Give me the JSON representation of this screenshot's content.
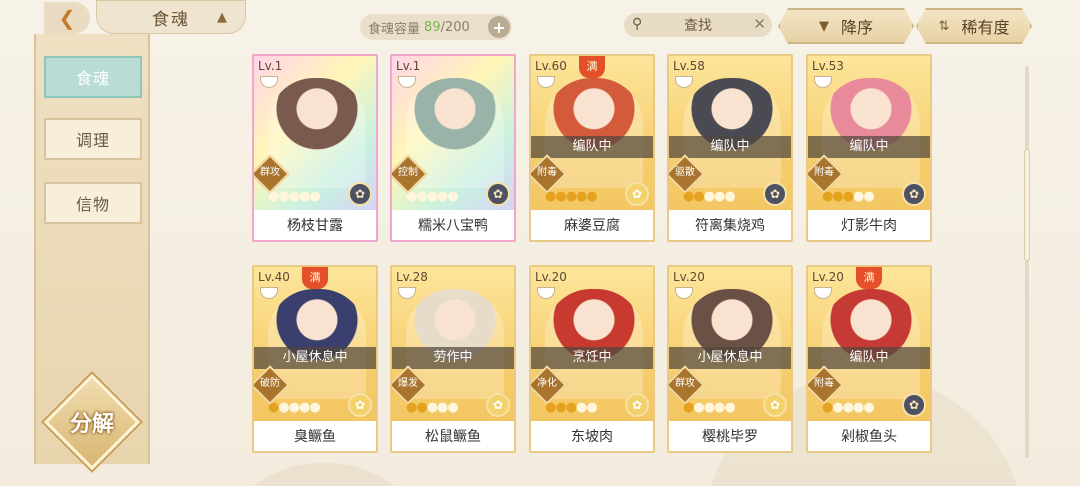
{
  "header": {
    "back_icon": "chevron-left-icon",
    "title": "食魂",
    "capacity_label": "食魂容量",
    "capacity_current": "89",
    "capacity_max": "/200",
    "search_label": "查找",
    "sort_order_label": "降序",
    "sort_key_label": "稀有度"
  },
  "sidebar": {
    "items": [
      {
        "label": "食魂",
        "active": true
      },
      {
        "label": "调理",
        "active": false
      },
      {
        "label": "信物",
        "active": false
      }
    ],
    "decompose_label": "分解"
  },
  "cards": [
    {
      "level": "Lv.1",
      "name": "杨枝甘露",
      "status": "",
      "role": "群攻",
      "stars": 0,
      "full": false,
      "rainbow": true,
      "flower": "dark",
      "portrait_color": "#7a5a4e"
    },
    {
      "level": "Lv.1",
      "name": "糯米八宝鸭",
      "status": "",
      "role": "控制",
      "stars": 0,
      "full": false,
      "rainbow": true,
      "flower": "dark",
      "portrait_color": "#9ab3a8"
    },
    {
      "level": "Lv.60",
      "name": "麻婆豆腐",
      "status": "编队中",
      "role": "附毒",
      "stars": 5,
      "full": true,
      "rainbow": false,
      "flower": "gold",
      "portrait_color": "#d45a3c"
    },
    {
      "level": "Lv.58",
      "name": "符离集烧鸡",
      "status": "编队中",
      "role": "驱散",
      "stars": 2,
      "full": false,
      "rainbow": false,
      "flower": "dark",
      "portrait_color": "#4a4a52"
    },
    {
      "level": "Lv.53",
      "name": "灯影牛肉",
      "status": "编队中",
      "role": "附毒",
      "stars": 3,
      "full": false,
      "rainbow": false,
      "flower": "dark",
      "portrait_color": "#e88a9a"
    },
    {
      "level": "Lv.40",
      "name": "臭鳜鱼",
      "status": "小屋休息中",
      "role": "破防",
      "stars": 1,
      "full": true,
      "rainbow": false,
      "flower": "gold",
      "portrait_color": "#3b3f6e"
    },
    {
      "level": "Lv.28",
      "name": "松鼠鳜鱼",
      "status": "劳作中",
      "role": "爆发",
      "stars": 2,
      "full": false,
      "rainbow": false,
      "flower": "gold",
      "portrait_color": "#e7dcc9"
    },
    {
      "level": "Lv.20",
      "name": "东坡肉",
      "status": "烹饪中",
      "role": "净化",
      "stars": 3,
      "full": false,
      "rainbow": false,
      "flower": "gold",
      "portrait_color": "#c83a30"
    },
    {
      "level": "Lv.20",
      "name": "樱桃毕罗",
      "status": "小屋休息中",
      "role": "群攻",
      "stars": 1,
      "full": false,
      "rainbow": false,
      "flower": "gold",
      "portrait_color": "#6b5046"
    },
    {
      "level": "Lv.20",
      "name": "剁椒鱼头",
      "status": "编队中",
      "role": "附毒",
      "stars": 1,
      "full": true,
      "rainbow": false,
      "flower": "dark",
      "portrait_color": "#c63a35"
    }
  ],
  "full_badge": "满"
}
